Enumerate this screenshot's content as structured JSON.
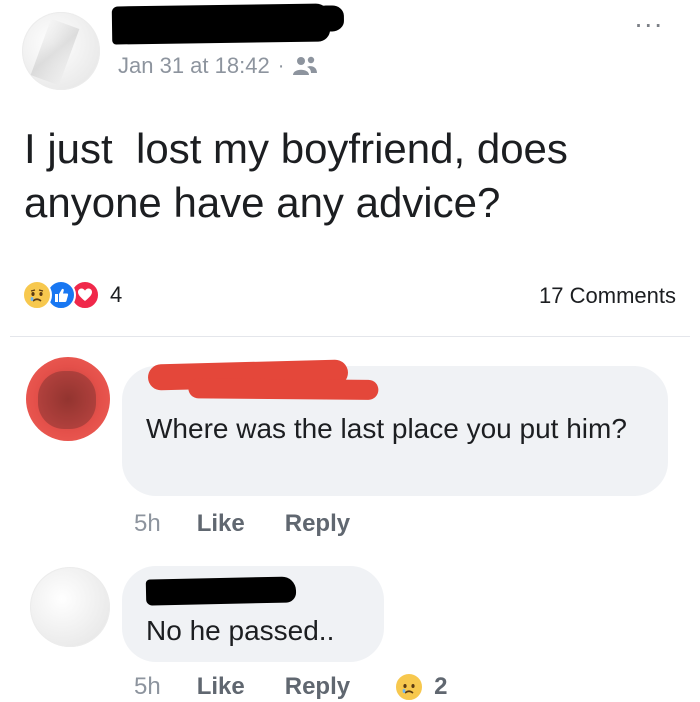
{
  "post": {
    "timestamp": "Jan 31 at 18:42",
    "separator": "·",
    "audience_icon": "friends-icon",
    "more_icon": "more-options-icon",
    "more_glyph": "...",
    "text": "I just  lost my boyfriend, does\nanyone have any advice?",
    "reactions": [
      "sad-reaction-icon",
      "like-reaction-icon",
      "love-reaction-icon"
    ],
    "reaction_count": "4",
    "comments_label": "17 Comments"
  },
  "comments": [
    {
      "text": "Where was the last place you put him?",
      "time": "5h",
      "like_label": "Like",
      "reply_label": "Reply"
    },
    {
      "text": "No he passed..",
      "time": "5h",
      "like_label": "Like",
      "reply_label": "Reply",
      "reaction_icon": "sad-reaction-icon",
      "reaction_count": "2"
    }
  ],
  "colors": {
    "like_blue": "#1877f2",
    "love_red": "#f0284a",
    "sad_yellow": "#f7c84e",
    "bubble_bg": "#f0f2f5",
    "meta_gray": "#8d949e",
    "redaction_red": "#e4473a"
  }
}
